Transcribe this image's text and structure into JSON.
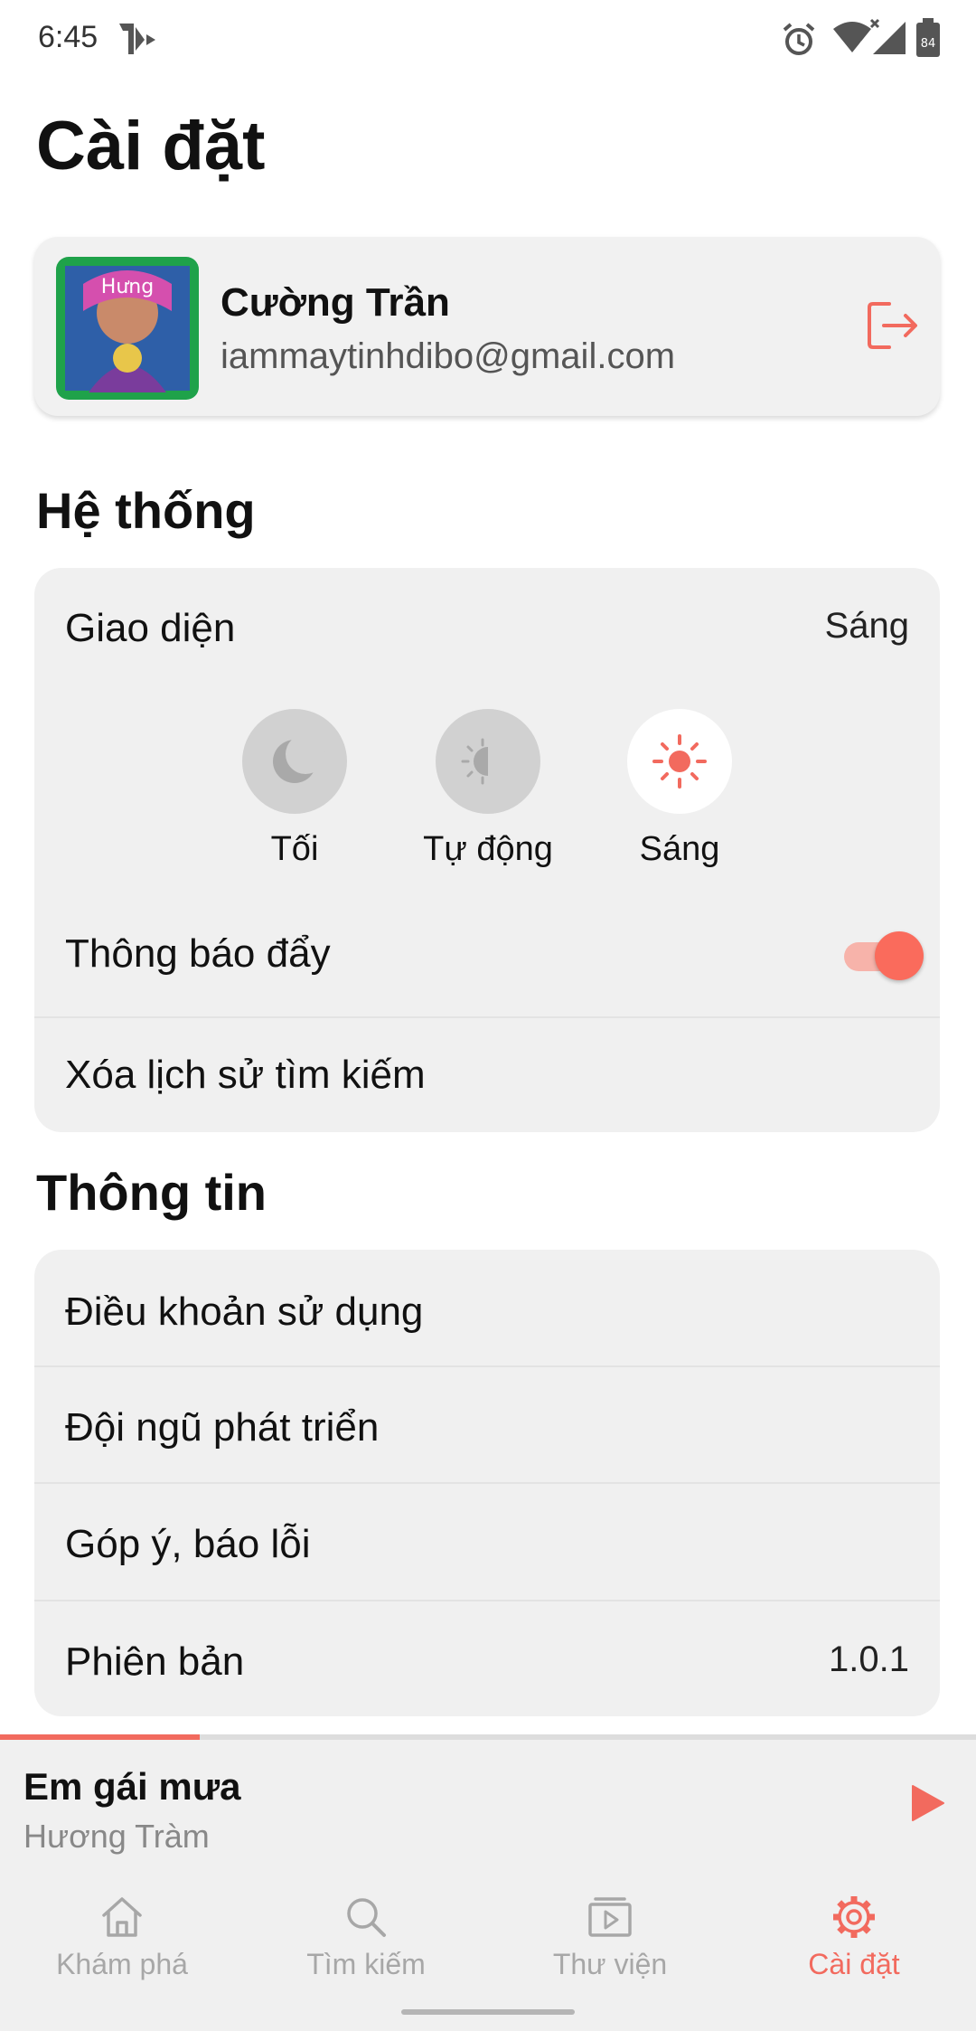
{
  "status_bar": {
    "time": "6:45",
    "battery": "84",
    "network": "4"
  },
  "page": {
    "title": "Cài đặt"
  },
  "profile": {
    "name": "Cường Trần",
    "email": "iammaytinhdibo@gmail.com"
  },
  "system_section": {
    "title": "Hệ thống",
    "appearance": {
      "label": "Giao diện",
      "value": "Sáng",
      "options": [
        {
          "label": "Tối",
          "icon": "moon-icon"
        },
        {
          "label": "Tự động",
          "icon": "auto-theme-icon"
        },
        {
          "label": "Sáng",
          "icon": "sun-icon"
        }
      ],
      "selected": "Sáng"
    },
    "push_notifications": {
      "label": "Thông báo đẩy",
      "enabled": true
    },
    "clear_search_history": {
      "label": "Xóa lịch sử tìm kiếm"
    }
  },
  "info_section": {
    "title": "Thông tin",
    "items": [
      {
        "label": "Điều khoản sử dụng"
      },
      {
        "label": "Đội ngũ phát triển"
      },
      {
        "label": "Góp ý, báo lỗi"
      },
      {
        "label": "Phiên bản",
        "value": "1.0.1"
      }
    ]
  },
  "now_playing": {
    "title": "Em gái mưa",
    "artist": "Hương Tràm",
    "progress": 0.205
  },
  "bottom_nav": {
    "items": [
      {
        "label": "Khám phá",
        "icon": "home-icon"
      },
      {
        "label": "Tìm kiếm",
        "icon": "search-icon"
      },
      {
        "label": "Thư viện",
        "icon": "library-icon"
      },
      {
        "label": "Cài đặt",
        "icon": "gear-icon"
      }
    ],
    "active": "Cài đặt"
  },
  "colors": {
    "accent": "#f26a5e",
    "card_bg": "#f0f0f0",
    "inactive": "#a7a7a7"
  }
}
